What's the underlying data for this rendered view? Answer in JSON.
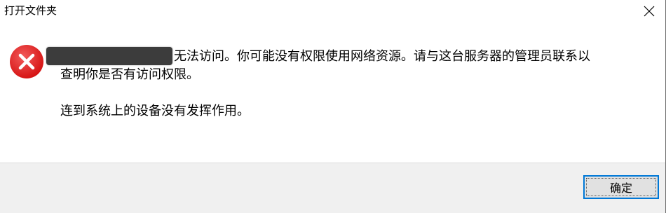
{
  "window": {
    "title": "打开文件夹"
  },
  "message": {
    "path_redacted": "",
    "line1_text": "无法访问。你可能没有权限使用网络资源。请与这台服务器的管理员联系以",
    "line2_text": "查明你是否有访问权限。",
    "line3_text": "连到系统上的设备没有发挥作用。"
  },
  "buttons": {
    "ok_label": "确定"
  },
  "icons": {
    "error": "error-icon",
    "close": "close-icon"
  },
  "colors": {
    "error_red": "#e81123",
    "focus_blue": "#0078d7",
    "footer_bg": "#f0f0f0"
  }
}
